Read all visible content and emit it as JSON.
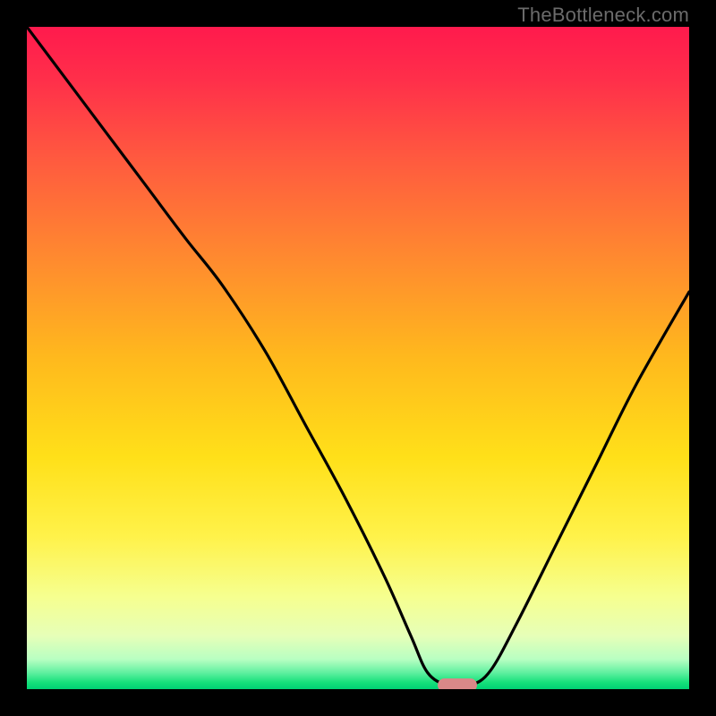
{
  "watermark": "TheBottleneck.com",
  "chart_data": {
    "type": "line",
    "title": "",
    "xlabel": "",
    "ylabel": "",
    "xlim": [
      0,
      100
    ],
    "ylim": [
      0,
      100
    ],
    "background_gradient_stops": [
      {
        "offset": 0.0,
        "color": "#ff1a4d"
      },
      {
        "offset": 0.08,
        "color": "#ff2f4a"
      },
      {
        "offset": 0.2,
        "color": "#ff5a3f"
      },
      {
        "offset": 0.35,
        "color": "#ff8a2f"
      },
      {
        "offset": 0.5,
        "color": "#ffb91d"
      },
      {
        "offset": 0.65,
        "color": "#ffe019"
      },
      {
        "offset": 0.77,
        "color": "#fff24a"
      },
      {
        "offset": 0.86,
        "color": "#f6ff8f"
      },
      {
        "offset": 0.92,
        "color": "#e6ffb8"
      },
      {
        "offset": 0.955,
        "color": "#b8ffc2"
      },
      {
        "offset": 0.975,
        "color": "#60f0a0"
      },
      {
        "offset": 0.99,
        "color": "#15e07a"
      },
      {
        "offset": 1.0,
        "color": "#00d074"
      }
    ],
    "series": [
      {
        "name": "bottleneck-curve",
        "color": "#000000",
        "x": [
          0,
          6,
          12,
          18,
          24,
          29.5,
          36,
          42,
          48,
          54,
          58,
          60.5,
          63.5,
          67,
          70,
          74,
          80,
          86,
          92,
          100
        ],
        "y": [
          100,
          92,
          84,
          76,
          68,
          61,
          51,
          40,
          29,
          17,
          8,
          2.5,
          0.6,
          0.6,
          2.8,
          10,
          22,
          34,
          46,
          60
        ]
      }
    ],
    "marker": {
      "name": "optimal-marker",
      "color": "#d98888",
      "x": 65,
      "y": 0.6,
      "width_pct": 6.0,
      "height_pct": 2.1
    }
  }
}
